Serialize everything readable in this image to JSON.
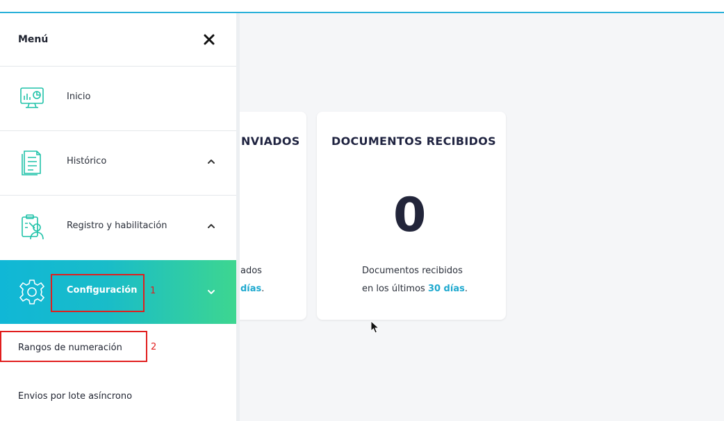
{
  "menu": {
    "title": "Menú",
    "items": [
      {
        "label": "Inicio",
        "icon": "dashboard-monitor-icon"
      },
      {
        "label": "Histórico",
        "icon": "document-list-icon"
      },
      {
        "label": "Registro y habilitación",
        "icon": "clipboard-user-icon"
      },
      {
        "label": "Configuración",
        "icon": "gear-icon"
      }
    ],
    "submenu": [
      {
        "label": "Rangos de numeración"
      },
      {
        "label": "Envios por lote asíncrono"
      }
    ]
  },
  "annotations": {
    "one": "1",
    "two": "2"
  },
  "cards": {
    "sent": {
      "title_visible": "NVIADOS",
      "line1_visible": "ados",
      "line2_highlight": "días",
      "line2_suffix": "."
    },
    "received": {
      "title": "DOCUMENTOS RECIBIDOS",
      "value": "0",
      "line1": "Documentos recibidos",
      "line2_prefix": "en los últimos ",
      "line2_highlight": "30 días",
      "line2_suffix": "."
    }
  },
  "colors": {
    "accent": "#1fa9cf",
    "active_gradient_start": "#10b7d6",
    "active_gradient_end": "#3dd690",
    "icon_teal": "#1fc2a8",
    "annotation_red": "#e11d1d"
  }
}
